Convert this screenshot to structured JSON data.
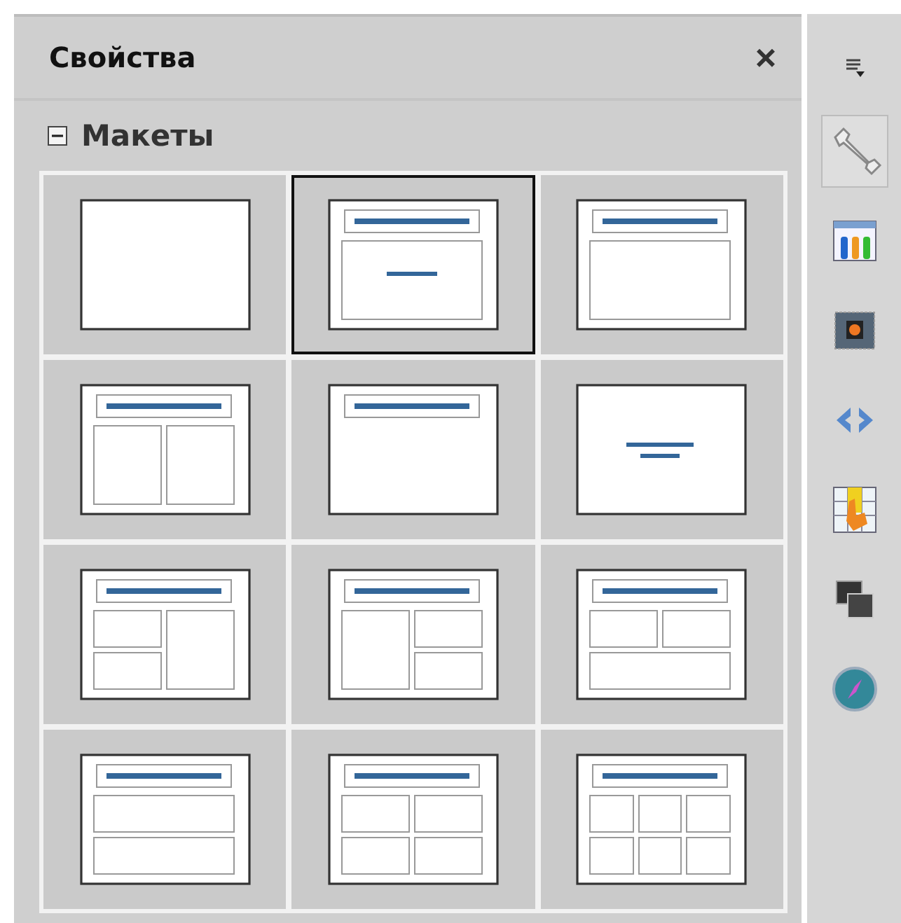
{
  "panel": {
    "title": "Свойства",
    "close": "×"
  },
  "section": {
    "title": "Макеты",
    "expanded": true
  },
  "layouts": [
    {
      "kind": "blank",
      "selected": false
    },
    {
      "kind": "title-centered",
      "selected": true
    },
    {
      "kind": "title-content",
      "selected": false
    },
    {
      "kind": "title-two-columns",
      "selected": false
    },
    {
      "kind": "title-only",
      "selected": false
    },
    {
      "kind": "centered-text",
      "selected": false
    },
    {
      "kind": "two-left-one-right",
      "selected": false
    },
    {
      "kind": "one-left-two-right",
      "selected": false
    },
    {
      "kind": "two-top-one-bottom",
      "selected": false
    },
    {
      "kind": "two-rows",
      "selected": false
    },
    {
      "kind": "four-cells",
      "selected": false
    },
    {
      "kind": "six-cells",
      "selected": false
    }
  ],
  "sidebar_tabs": [
    {
      "selected": true
    },
    {
      "selected": false
    },
    {
      "selected": false
    },
    {
      "selected": false
    },
    {
      "selected": false
    },
    {
      "selected": false
    },
    {
      "selected": false
    }
  ]
}
